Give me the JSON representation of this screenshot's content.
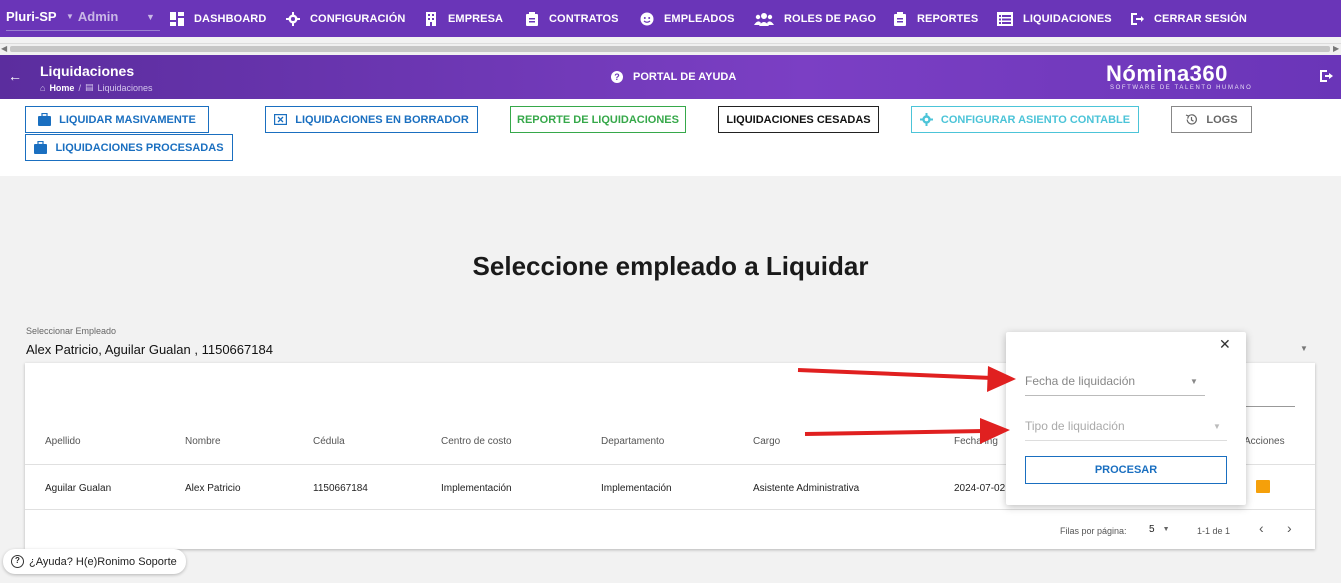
{
  "topnav": {
    "company": "Pluri-SP",
    "role": "Admin",
    "items": [
      {
        "label": "DASHBOARD",
        "icon": "dashboard-icon"
      },
      {
        "label": "CONFIGURACIÓN",
        "icon": "gear-icon"
      },
      {
        "label": "EMPRESA",
        "icon": "building-icon"
      },
      {
        "label": "CONTRATOS",
        "icon": "clipboard-icon"
      },
      {
        "label": "EMPLEADOS",
        "icon": "face-icon"
      },
      {
        "label": "ROLES DE PAGO",
        "icon": "group-icon"
      },
      {
        "label": "REPORTES",
        "icon": "clipboard-icon"
      },
      {
        "label": "LIQUIDACIONES",
        "icon": "list-icon"
      },
      {
        "label": "CERRAR SESIÓN",
        "icon": "logout-icon"
      }
    ]
  },
  "header": {
    "title": "Liquidaciones",
    "breadcrumb_home": "Home",
    "breadcrumb_separator": "/",
    "breadcrumb_current": "Liquidaciones",
    "help_label": "PORTAL DE AYUDA",
    "brand": "Nómina360",
    "brand_sub": "SOFTWARE DE TALENTO HUMANO"
  },
  "actions": {
    "liquidar_masivamente": "LIQUIDAR MASIVAMENTE",
    "en_borrador": "LIQUIDACIONES EN BORRADOR",
    "reporte": "REPORTE DE LIQUIDACIONES",
    "cesadas": "LIQUIDACIONES CESADAS",
    "asiento": "CONFIGURAR ASIENTO CONTABLE",
    "logs": "LOGS",
    "procesadas": "LIQUIDACIONES PROCESADAS"
  },
  "colors": {
    "brand_purple": "#6a35b8",
    "primary_blue": "#1a6fc0",
    "success_green": "#36a84a",
    "info_cyan": "#4cc4d8",
    "warning_orange": "#f5a00a",
    "annotation_red": "#e02020"
  },
  "main": {
    "title": "Seleccione empleado a Liquidar",
    "select_label": "Seleccionar Empleado",
    "select_value": "Alex Patricio, Aguilar Gualan , 1150667184"
  },
  "table": {
    "headers": [
      "Apellido",
      "Nombre",
      "Cédula",
      "Centro de costo",
      "Departamento",
      "Cargo",
      "Fecha ing",
      "Acciones"
    ],
    "rows": [
      [
        "Aguilar Gualan",
        "Alex Patricio",
        "1150667184",
        "Implementación",
        "Implementación",
        "Asistente Administrativa",
        "2024-07-02"
      ]
    ],
    "pagination": {
      "rows_label": "Filas por página:",
      "rows_value": "5",
      "range": "1-1 de 1"
    }
  },
  "popup": {
    "fecha_placeholder": "Fecha de liquidación",
    "tipo_placeholder": "Tipo de liquidación",
    "process_label": "PROCESAR"
  },
  "help_pill": {
    "label": "¿Ayuda? H(e)Ronimo Soporte"
  }
}
